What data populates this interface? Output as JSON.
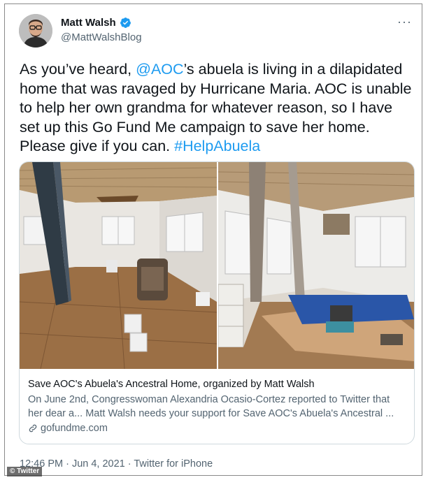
{
  "tweet": {
    "author": {
      "display_name": "Matt Walsh",
      "handle": "@MattWalshBlog",
      "verified": true,
      "avatar_icon": "profile-photo"
    },
    "more_label": "···",
    "text": {
      "part1": "As you’ve heard, ",
      "mention": "@AOC",
      "part2": "’s abuela is living in a dilapidated home that was ravaged by Hurricane Maria. AOC is unable to help her own grandma for whatever reason, so I have set up this Go Fund Me campaign to save her home. Please give if you can. ",
      "hashtag": "#HelpAbuela"
    },
    "card": {
      "title": "Save AOC's Abuela's Ancestral Home, organized by Matt Walsh",
      "description": "On June 2nd, Congresswoman Alexandria Ocasio-Cortez reported to Twitter  that her dear a... Matt Walsh needs your support for Save AOC's Abuela's Ancestral ...",
      "domain": "gofundme.com",
      "images": [
        "room-with-pillar-and-buckets",
        "room-with-debris-and-bed-frame"
      ]
    },
    "meta": "12:46 PM · Jun 4, 2021 · Twitter for iPhone"
  },
  "watermark": "© Twitter",
  "colors": {
    "link": "#1d9bf0",
    "secondary_text": "#536471",
    "primary_text": "#0f1419",
    "verified": "#1d9bf0"
  }
}
